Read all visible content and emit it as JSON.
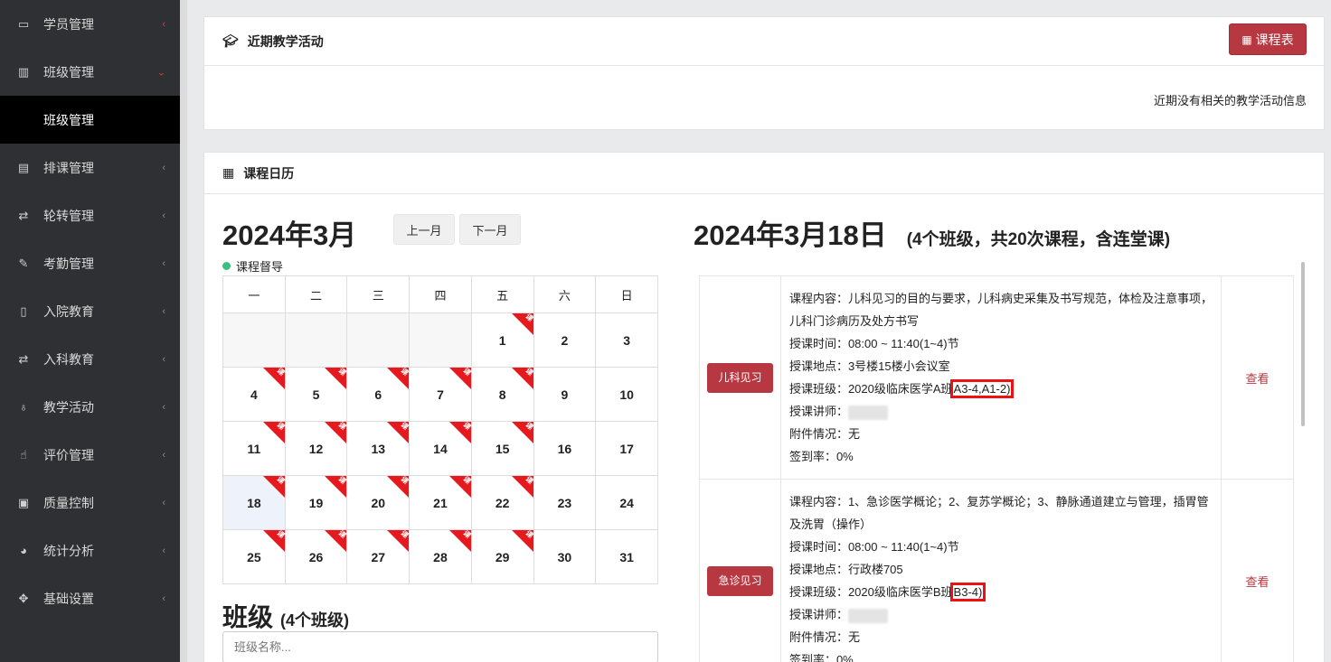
{
  "sidebar": {
    "items": [
      {
        "label": "学员管理",
        "icon": "id-card-icon"
      },
      {
        "label": "班级管理",
        "icon": "building-icon"
      },
      {
        "label": "排课管理",
        "icon": "file-icon"
      },
      {
        "label": "轮转管理",
        "icon": "rotate-icon"
      },
      {
        "label": "考勤管理",
        "icon": "brush-icon"
      },
      {
        "label": "入院教育",
        "icon": "clipboard-icon"
      },
      {
        "label": "入科教育",
        "icon": "rotate-icon"
      },
      {
        "label": "教学活动",
        "icon": "stethoscope-icon"
      },
      {
        "label": "评价管理",
        "icon": "thumbs-up-icon"
      },
      {
        "label": "质量控制",
        "icon": "newspaper-icon"
      },
      {
        "label": "统计分析",
        "icon": "pie-chart-icon"
      },
      {
        "label": "基础设置",
        "icon": "arrows-icon"
      }
    ],
    "sub_item": "班级管理"
  },
  "activity": {
    "title": "近期教学活动",
    "schedule_button": "课程表",
    "empty_message": "近期没有相关的教学活动信息"
  },
  "calendar": {
    "panel_title": "课程日历",
    "month_title": "2024年3月",
    "prev_label": "上一月",
    "next_label": "下一月",
    "legend": "课程督导",
    "weekdays": [
      "一",
      "二",
      "三",
      "四",
      "五",
      "六",
      "日"
    ],
    "badge_text": "课",
    "weeks": [
      [
        "",
        "",
        "",
        "",
        "1",
        "2",
        "3"
      ],
      [
        "4",
        "5",
        "6",
        "7",
        "8",
        "9",
        "10"
      ],
      [
        "11",
        "12",
        "13",
        "14",
        "15",
        "16",
        "17"
      ],
      [
        "18",
        "19",
        "20",
        "21",
        "22",
        "23",
        "24"
      ],
      [
        "25",
        "26",
        "27",
        "28",
        "29",
        "30",
        "31"
      ]
    ],
    "course_days": [
      1,
      4,
      5,
      6,
      7,
      8,
      11,
      12,
      13,
      14,
      15,
      18,
      19,
      20,
      21,
      22,
      25,
      26,
      27,
      28,
      29
    ],
    "today": 18
  },
  "classes": {
    "title": "班级",
    "count": "(4个班级)",
    "search_placeholder": "班级名称..."
  },
  "day": {
    "title": "2024年3月18日",
    "summary": "(4个班级，共20次课程，含连堂课)"
  },
  "courses": [
    {
      "type": "儿科见习",
      "content": "课程内容：儿科见习的目的与要求，儿科病史采集及书写规范，体检及注意事项，儿科门诊病历及处方书写",
      "time": "授课时间：08:00 ~ 11:40(1~4)节",
      "place": "授课地点：3号楼15楼小会议室",
      "class_prefix": "授课班级：2020级临床医学A班",
      "class_highlight": "A3-4,A1-2)",
      "teacher": "授课讲师：",
      "attachment": "附件情况：无",
      "signin": "签到率：0%",
      "view": "查看"
    },
    {
      "type": "急诊见习",
      "content": "课程内容：1、急诊医学概论；2、复苏学概论；3、静脉通道建立与管理，插胃管及洗胃（操作）",
      "time": "授课时间：08:00 ~ 11:40(1~4)节",
      "place": "授课地点：行政楼705",
      "class_prefix": "授课班级：2020级临床医学B班",
      "class_highlight": "B3-4)",
      "teacher": "授课讲师：",
      "attachment": "附件情况：无",
      "signin": "签到率：0%",
      "view": "查看"
    }
  ],
  "colors": {
    "accent": "#b73840",
    "sidebar_bg": "#2f3033",
    "badge": "#e6191f",
    "legend_dot": "#3cbf82"
  }
}
